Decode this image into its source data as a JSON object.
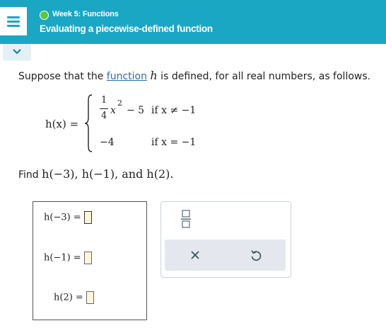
{
  "header": {
    "week_label": "Week 5: Functions",
    "title": "Evaluating a piecewise-defined function",
    "accent_color": "#1aa7c4",
    "status_dot_color": "#5cc93b"
  },
  "problem": {
    "prompt_before": "Suppose that the ",
    "prompt_link": "function",
    "prompt_var": "h",
    "prompt_after": " is defined, for all real numbers, as follows.",
    "func_lhs": "h(x) =",
    "frac_num": "1",
    "frac_den": "4",
    "piece1_expr": "x",
    "piece1_exp": "2",
    "piece1_rest": "− 5",
    "piece1_cond": "if x ≠ −1",
    "piece2_expr": "−4",
    "piece2_cond": "if x = −1",
    "find_label": "Find",
    "find_expr": "h(−3), h(−1), and h(2)."
  },
  "answers": [
    {
      "label": "h(−3) =",
      "value": ""
    },
    {
      "label": "h(−1) =",
      "value": ""
    },
    {
      "label": "h(2) =",
      "value": ""
    }
  ],
  "tools": {
    "fraction_icon": "fraction-icon",
    "clear_icon": "x-icon",
    "undo_icon": "undo-icon"
  }
}
